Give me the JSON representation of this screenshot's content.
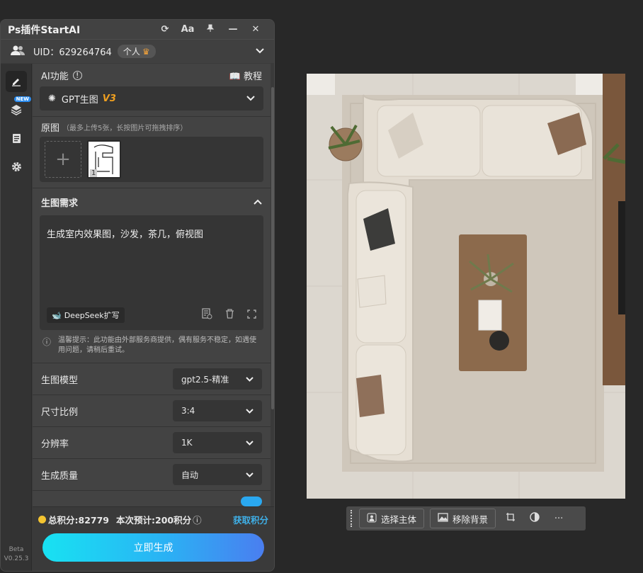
{
  "window": {
    "title": "Ps插件StartAI",
    "controls": [
      "⟳",
      "Aa",
      "📌",
      "—",
      "✕"
    ]
  },
  "user": {
    "uid": "UID：629264764",
    "plan": "个人"
  },
  "rail": {
    "new_badge": "NEW",
    "version_line1": "Beta",
    "version_line2": "V0.25.3"
  },
  "ai": {
    "label": "AI功能",
    "tutorial": "教程",
    "model_name": "GPT生图",
    "model_version": "V3"
  },
  "original": {
    "label": "原图",
    "hint": "（最多上传5张，长按图片可拖拽排序）",
    "add_symbol": "+",
    "thumb_index": "1"
  },
  "generation": {
    "label": "生图需求",
    "prompt": "生成室内效果图，沙发，茶几，俯视图",
    "deepseek_label": "DeepSeek扩写"
  },
  "tip": {
    "text": "温馨提示：此功能由外部服务商提供，偶有服务不稳定，如遇使用问题，请稍后重试。"
  },
  "options": [
    {
      "label": "生图模型",
      "value": "gpt2.5-精准"
    },
    {
      "label": "尺寸比例",
      "value": "3:4"
    },
    {
      "label": "分辨率",
      "value": "1K"
    },
    {
      "label": "生成质量",
      "value": "自动"
    }
  ],
  "footer": {
    "points_total": "总积分:82779",
    "points_estimate": "本次预计:200积分",
    "get_points": "获取积分",
    "generate": "立即生成"
  },
  "image_toolbar": {
    "select_subject": "选择主体",
    "remove_bg": "移除背景",
    "more": "···"
  },
  "colors": {
    "accent_blue": "#3fb0e8",
    "version_orange": "#f0a020",
    "button_gradient_start": "#18e2f2",
    "button_gradient_end": "#4a7ef0"
  }
}
